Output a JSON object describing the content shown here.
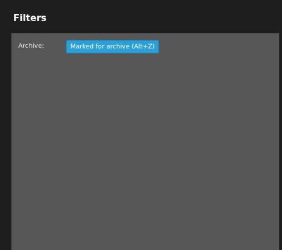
{
  "panel": {
    "title": "Filters"
  },
  "filters": {
    "archive": {
      "label": "Archive:",
      "value": "Marked for archive (Alt+Z)",
      "value_color": "#2a9fd8"
    }
  }
}
